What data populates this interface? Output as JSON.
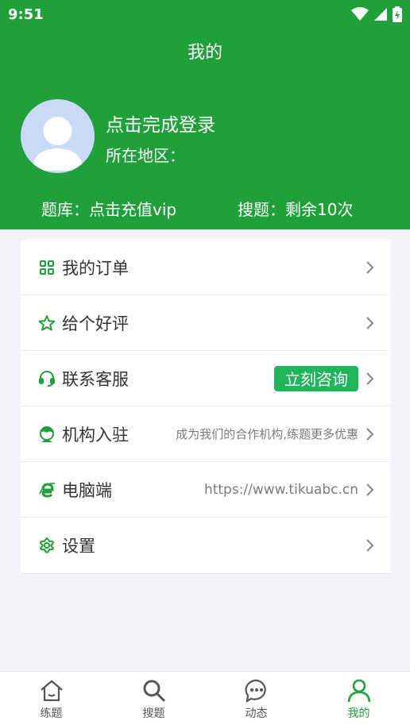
{
  "status": {
    "time": "9:51"
  },
  "header": {
    "title": "我的",
    "login_prompt": "点击完成登录",
    "region_label": "所在地区：",
    "bank_info": "题库：点击充值vip",
    "search_info": "搜题：剩余10次"
  },
  "menu": [
    {
      "label": "我的订单",
      "icon": "grid-icon"
    },
    {
      "label": "给个好评",
      "icon": "star-icon"
    },
    {
      "label": "联系客服",
      "icon": "headset-icon",
      "button": "立刻咨询"
    },
    {
      "label": "机构入驻",
      "icon": "person-icon",
      "extra": "成为我们的合作机构,练题更多优惠"
    },
    {
      "label": "电脑端",
      "icon": "browser-e-icon",
      "extra": "https://www.tikuabc.cn"
    },
    {
      "label": "设置",
      "icon": "flower-settings-icon"
    }
  ],
  "tabs": [
    {
      "label": "练题",
      "icon": "home-icon"
    },
    {
      "label": "搜题",
      "icon": "search-icon"
    },
    {
      "label": "动态",
      "icon": "chat-icon"
    },
    {
      "label": "我的",
      "icon": "user-icon",
      "active": true
    }
  ],
  "colors": {
    "brand": "#20a03a",
    "cta": "#20b45b",
    "background": "#f2f4f9"
  }
}
